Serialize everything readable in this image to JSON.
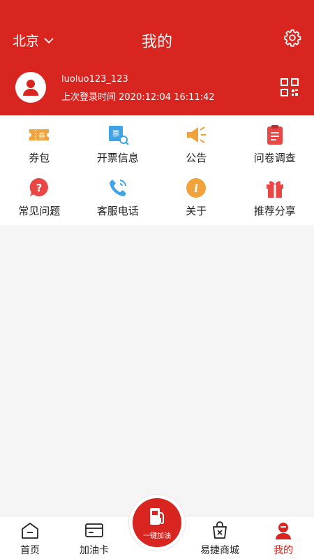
{
  "header": {
    "city": "北京",
    "title": "我的",
    "username": "luoluo123_123",
    "last_login": "上次登录时间 2020:12:04 16:11:42",
    "accent_color": "#d9251f"
  },
  "menu": [
    {
      "label": "券包",
      "icon": "coupon-icon"
    },
    {
      "label": "开票信息",
      "icon": "invoice-icon"
    },
    {
      "label": "公告",
      "icon": "megaphone-icon"
    },
    {
      "label": "问卷调查",
      "icon": "clipboard-icon"
    },
    {
      "label": "常见问题",
      "icon": "question-icon"
    },
    {
      "label": "客服电话",
      "icon": "phone-icon"
    },
    {
      "label": "关于",
      "icon": "info-icon"
    },
    {
      "label": "推荐分享",
      "icon": "gift-icon"
    }
  ],
  "tabs": {
    "home": "首页",
    "card": "加油卡",
    "refuel": "一键加油",
    "mall": "易捷商城",
    "mine": "我的"
  }
}
